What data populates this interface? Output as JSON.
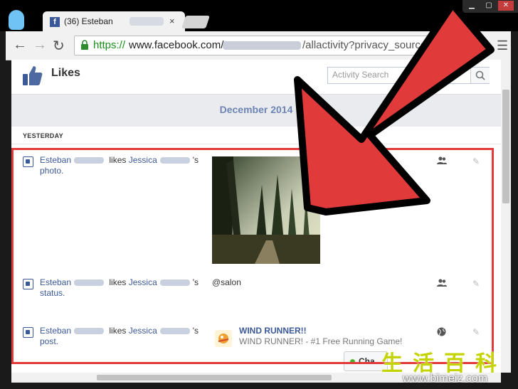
{
  "browser": {
    "tab_title": "(36) Esteban",
    "tab_close": "×",
    "url_scheme": "https://",
    "url_host": "www.facebook.com/",
    "url_path": "/allactivity?privacy_source=act",
    "back_icon": "arrow-left-icon",
    "forward_icon": "arrow-right-icon",
    "reload_icon": "reload-icon",
    "star_icon": "star-icon",
    "menu_icon": "hamburger-menu-icon",
    "window_buttons": [
      "minimize-icon",
      "maximize-icon",
      "close-icon"
    ]
  },
  "page": {
    "section_title": "Likes",
    "search_placeholder": "Activity Search",
    "month": "December 2014",
    "day_label": "YESTERDAY",
    "chat_label": "Cha"
  },
  "activities": [
    {
      "actor": "Esteban",
      "verb": "likes",
      "target": "Jessica",
      "suffix": "'s",
      "object": "photo.",
      "content_type": "photo",
      "audience_icon": "friends-icon"
    },
    {
      "actor": "Esteban",
      "verb": "likes",
      "target": "Jessica",
      "suffix": "'s",
      "object": "status.",
      "content_text": "@salon",
      "audience_icon": "friends-icon"
    },
    {
      "actor": "Esteban",
      "verb": "likes",
      "target": "Jessica",
      "suffix": "'s",
      "object": "post.",
      "app_title": "WIND RUNNER!!",
      "app_desc": "WIND RUNNER! - #1 Free Running Game!",
      "audience_icon": "globe-icon"
    }
  ],
  "watermark": {
    "chars": "生活百科",
    "url": "www.bimeiz.com"
  },
  "colors": {
    "highlight": "#e03a3a",
    "arrow_fill": "#e03a3a",
    "arrow_outline": "#000000",
    "fb_blue": "#3b5998"
  }
}
